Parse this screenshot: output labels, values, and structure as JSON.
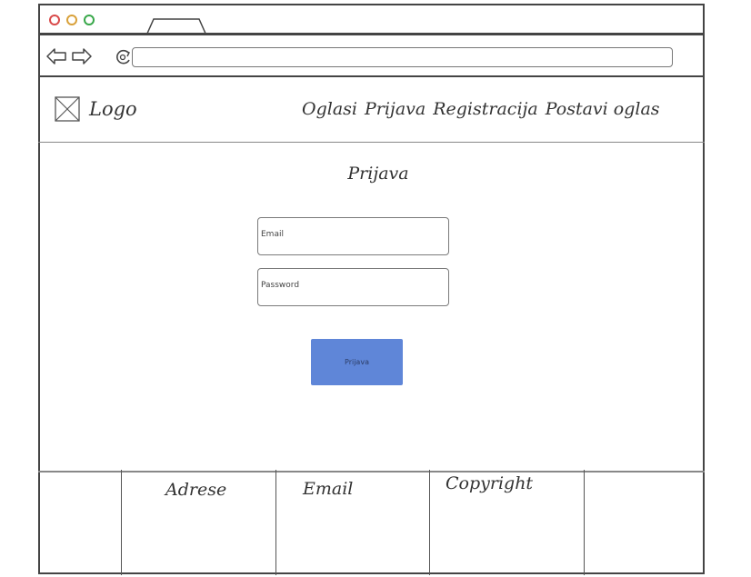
{
  "header": {
    "logo_label": "Logo",
    "nav": {
      "oglasi": "Oglasi",
      "prijava": "Prijava",
      "registracija": "Registracija",
      "postavi_oglas": "Postavi oglas"
    }
  },
  "main": {
    "title": "Prijava",
    "email_placeholder": "Email",
    "password_placeholder": "Password",
    "submit_label": "Prijava"
  },
  "footer": {
    "col1": "Adrese",
    "col2": "Email",
    "col3": "Copyright"
  },
  "colors": {
    "button_bg": "#5f86d8",
    "dot_red": "#d94a4a",
    "dot_yellow": "#d9a13a",
    "dot_green": "#39a84a"
  },
  "icons": {
    "back": "back-arrow-icon",
    "forward": "forward-arrow-icon",
    "reload": "reload-icon",
    "logo": "logo-placeholder-icon"
  }
}
